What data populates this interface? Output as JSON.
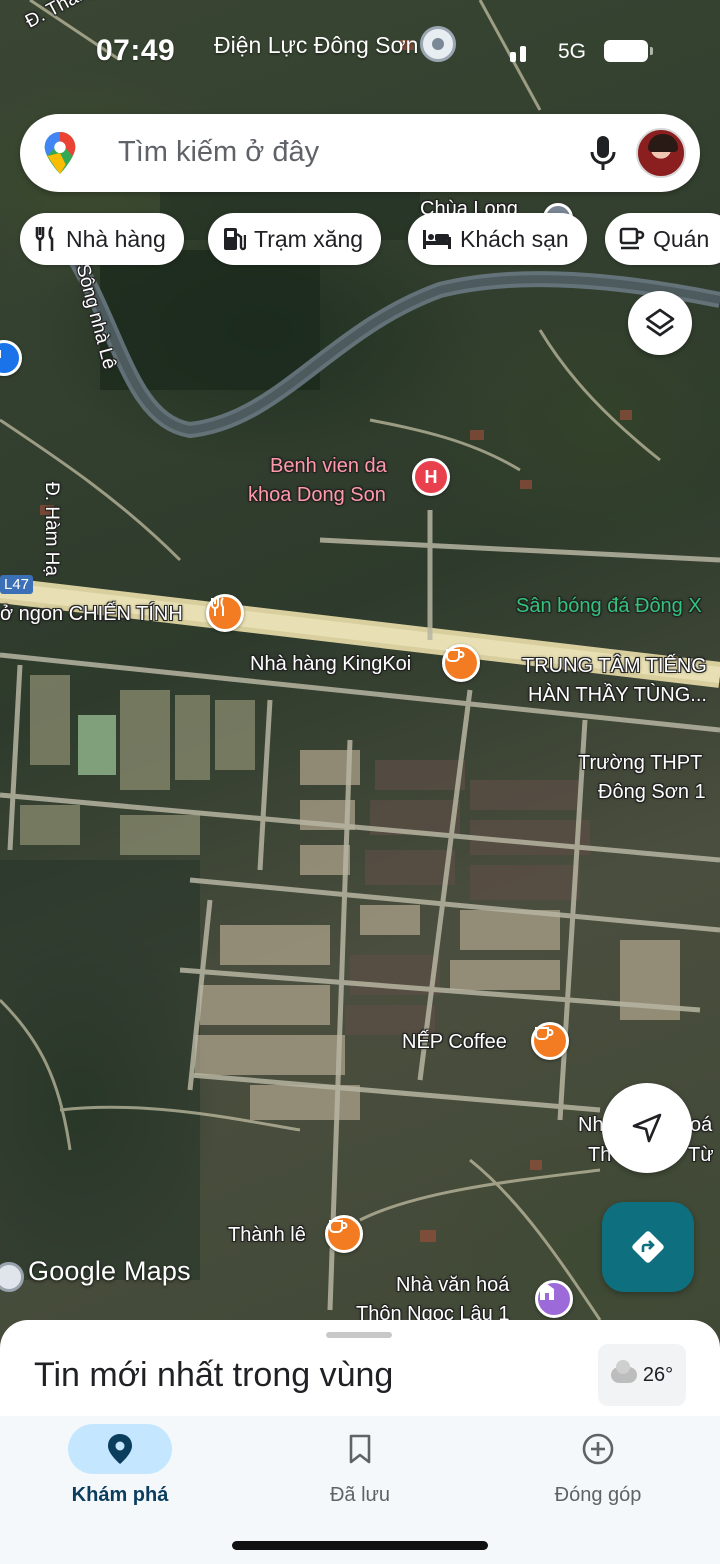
{
  "status_bar": {
    "time": "07:49",
    "place": "Điện Lực Đông Sơn",
    "network": "5G"
  },
  "search": {
    "placeholder": "Tìm kiếm ở đây"
  },
  "chips": [
    {
      "label": "Nhà hàng",
      "icon": "restaurant-icon"
    },
    {
      "label": "Trạm xăng",
      "icon": "gas-station-icon"
    },
    {
      "label": "Khách sạn",
      "icon": "hotel-icon"
    },
    {
      "label": "Quán",
      "icon": "cafe-icon"
    }
  ],
  "map": {
    "road_thang_binh": "Đ. Thắng B",
    "road_song_nha_le": "Sông nhà Lê",
    "road_ham_ha": "Đ. Hàm Hạ",
    "road_badge": "L47",
    "chua_long": "Chùa Long",
    "hospital": "Benh vien da khoa Dong Son",
    "restaurant_chien_tinh": "ở ngon CHIẾN TÍNH",
    "stadium": "Sân bóng đá Đông X",
    "kingkoi": "Nhà hàng KingKoi",
    "language_center_1": "TRUNG TÂM TIẾNG",
    "language_center_2": "HÀN THẦY TÙNG...",
    "school_1": "Trường THPT",
    "school_2": "Đông Sơn 1",
    "nep_coffee": "NẾP Coffee",
    "nha_partial_1": "Nh",
    "nha_partial_2": "Th",
    "hoa_partial": "oá",
    "tu_partial": "Từ",
    "thanh_le": "Thành lê",
    "cultural_house_1": "Nhà văn hoá",
    "cultural_house_2": "Thôn Ngọc Lâu 1",
    "google_logo": "Google Maps"
  },
  "sheet": {
    "title": "Tin mới nhất trong vùng",
    "temperature": "26°"
  },
  "nav": [
    {
      "label": "Khám phá",
      "icon": "explore-pin-icon",
      "active": true
    },
    {
      "label": "Đã lưu",
      "icon": "bookmark-icon",
      "active": false
    },
    {
      "label": "Đóng góp",
      "icon": "add-circle-icon",
      "active": false
    }
  ],
  "colors": {
    "accent_blue": "#0b57d0",
    "nav_active_pill": "#c4e7ff",
    "directions_button": "#0e6f7e",
    "poi_orange": "#f37c22",
    "poi_red": "#e8404c",
    "poi_purple": "#9d6bd9"
  }
}
